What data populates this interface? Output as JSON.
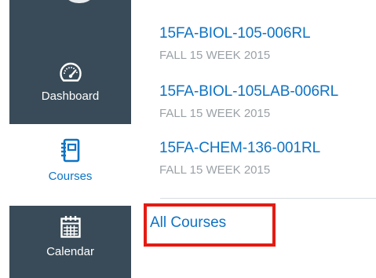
{
  "nav": {
    "dashboard_label": "Dashboard",
    "courses_label": "Courses",
    "calendar_label": "Calendar"
  },
  "courses": [
    {
      "name": "15FA-BIOL-105-006RL",
      "term": "FALL 15 WEEK 2015"
    },
    {
      "name": "15FA-BIOL-105LAB-006RL",
      "term": "FALL 15 WEEK 2015"
    },
    {
      "name": "15FA-CHEM-136-001RL",
      "term": "FALL 15 WEEK 2015"
    }
  ],
  "all_courses_label": "All Courses",
  "colors": {
    "nav_bg": "#394b58",
    "link": "#0e73c4",
    "term_text": "#9aa1a6",
    "highlight": "#e41b13"
  },
  "icons": [
    "speedometer-icon",
    "notebook-icon",
    "calendar-icon"
  ]
}
